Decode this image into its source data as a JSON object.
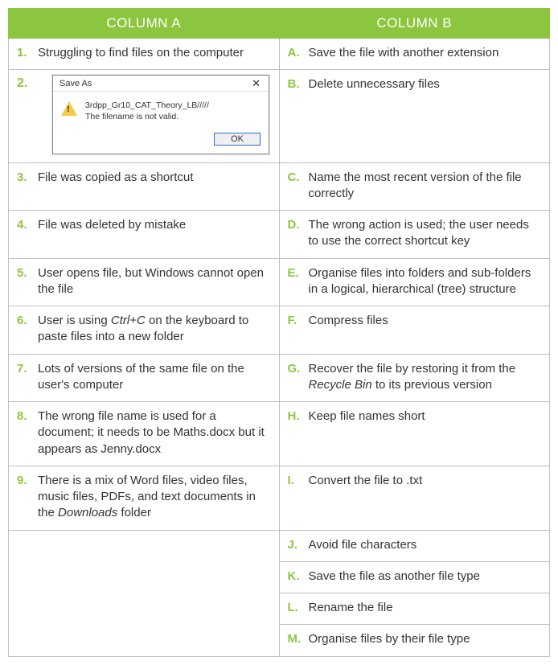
{
  "headers": {
    "a": "COLUMN A",
    "b": "COLUMN B"
  },
  "colA": [
    {
      "n": "1.",
      "t": "Struggling to find files on the computer"
    },
    {
      "n": "2.",
      "t": ""
    },
    {
      "n": "3.",
      "t": "File was copied as a shortcut"
    },
    {
      "n": "4.",
      "t": "File was deleted by mistake"
    },
    {
      "n": "5.",
      "t": "User opens file, but Windows cannot open the file"
    },
    {
      "n": "6.",
      "t_html": "User is using <em>Ctrl</em>+<em>C</em> on the keyboard to paste files into a new folder"
    },
    {
      "n": "7.",
      "t": "Lots of versions of the same file on the user's computer"
    },
    {
      "n": "8.",
      "t": "The wrong file name is used for a document; it needs to be Maths.docx but it appears as Jenny.docx"
    },
    {
      "n": "9.",
      "t_html": "There is a mix of Word files, video files, music files, PDFs, and text documents in the <em>Downloads</em> folder"
    }
  ],
  "colB": [
    {
      "n": "A.",
      "t": "Save the file with another extension"
    },
    {
      "n": "B.",
      "t": "Delete unnecessary files"
    },
    {
      "n": "C.",
      "t": "Name the most recent version of the file correctly"
    },
    {
      "n": "D.",
      "t": "The wrong action is used; the user needs to use the correct shortcut key"
    },
    {
      "n": "E.",
      "t": "Organise files into folders and sub-folders in a logical, hierarchical (tree) structure"
    },
    {
      "n": "F.",
      "t": "Compress files"
    },
    {
      "n": "G.",
      "t_html": "Recover the file by restoring it from the <em>Recycle Bin</em> to its previous version"
    },
    {
      "n": "H.",
      "t": "Keep file names short"
    },
    {
      "n": "I.",
      "t": "Convert the file to .txt"
    },
    {
      "n": "J.",
      "t": "Avoid file characters"
    },
    {
      "n": "K.",
      "t": "Save the file as another file type"
    },
    {
      "n": "L.",
      "t": "Rename the file"
    },
    {
      "n": "M.",
      "t": "Organise files by their file type"
    }
  ],
  "dialog": {
    "title": "Save As",
    "line1": "3rdpp_Gr10_CAT_Theory_LB/////",
    "line2": "The filename is not valid.",
    "ok": "OK"
  }
}
